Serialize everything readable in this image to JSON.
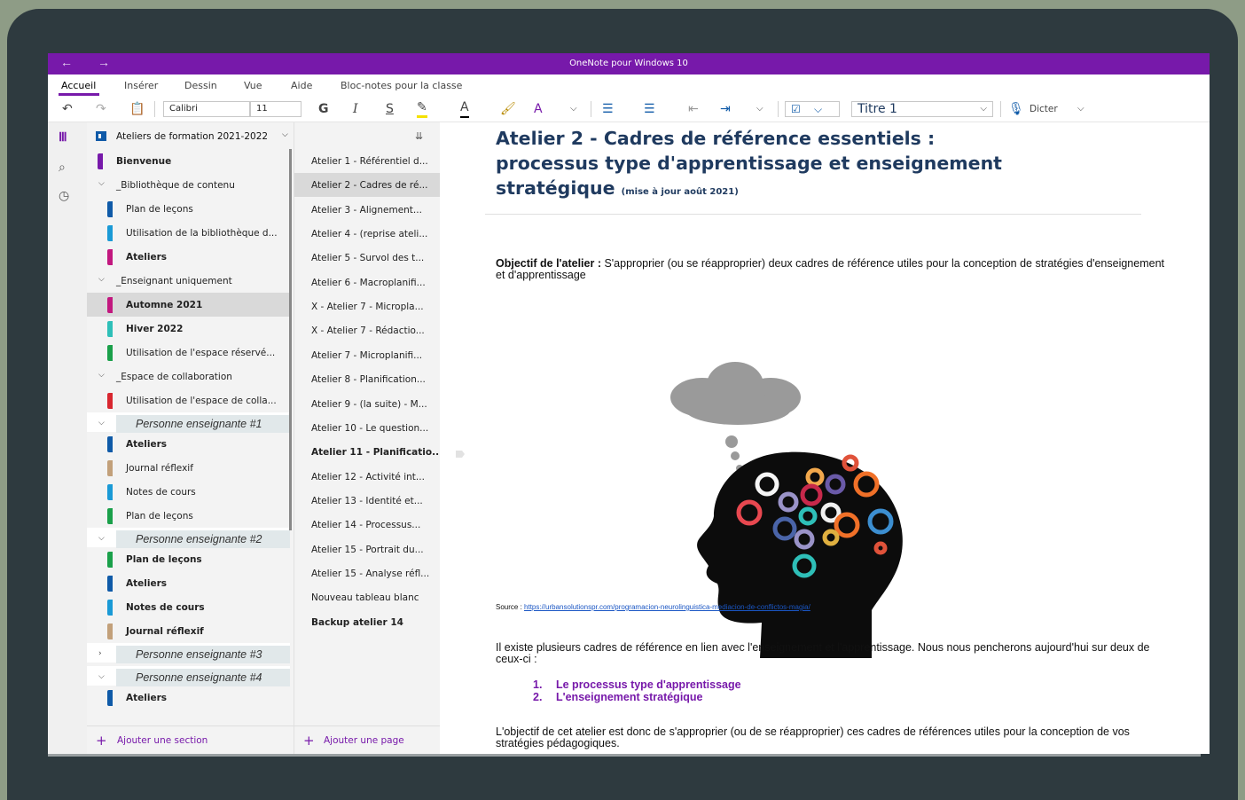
{
  "app": {
    "window_title": "OneNote pour Windows 10",
    "nav_back": "←",
    "nav_forward": "→"
  },
  "ribbon": {
    "tabs": [
      "Accueil",
      "Insérer",
      "Dessin",
      "Vue",
      "Aide",
      "Bloc-notes pour la classe"
    ],
    "active_tab": "Accueil"
  },
  "toolbar": {
    "font_name": "Calibri",
    "font_size": "11",
    "bold": "G",
    "italic": "I",
    "underline": "S",
    "style": "Titre 1",
    "dictate": "Dicter"
  },
  "notebook": {
    "title": "Ateliers de formation 2021-2022"
  },
  "sections": [
    {
      "label": "Bienvenue",
      "kind": "section",
      "color": "#7719aa",
      "bold": true,
      "indent": 0
    },
    {
      "label": "_Bibliothèque de contenu",
      "kind": "group",
      "expanded": true
    },
    {
      "label": "Plan de leçons",
      "kind": "section",
      "color": "#0f5aa8",
      "bold": false,
      "indent": 1
    },
    {
      "label": "Utilisation de la bibliothèque d...",
      "kind": "section",
      "color": "#1a9ad6",
      "bold": false,
      "indent": 1
    },
    {
      "label": "Ateliers",
      "kind": "section",
      "color": "#c2187f",
      "bold": true,
      "indent": 1
    },
    {
      "label": "_Enseignant uniquement",
      "kind": "group",
      "expanded": true
    },
    {
      "label": "Automne 2021",
      "kind": "section",
      "color": "#c2187f",
      "bold": true,
      "indent": 1,
      "selected": true
    },
    {
      "label": "Hiver 2022",
      "kind": "section",
      "color": "#2ebfb8",
      "bold": true,
      "indent": 1
    },
    {
      "label": "Utilisation de l'espace réservé...",
      "kind": "section",
      "color": "#1aa04a",
      "bold": false,
      "indent": 1
    },
    {
      "label": "_Espace de collaboration",
      "kind": "group",
      "expanded": true
    },
    {
      "label": "Utilisation de l'espace de colla...",
      "kind": "section",
      "color": "#d8262f",
      "bold": false,
      "indent": 1
    },
    {
      "label": "Personne enseignante #1",
      "kind": "group-italic",
      "expanded": true
    },
    {
      "label": "Ateliers",
      "kind": "section",
      "color": "#0f5aa8",
      "bold": true,
      "indent": 1
    },
    {
      "label": "Journal réflexif",
      "kind": "section",
      "color": "#c2a07a",
      "bold": false,
      "indent": 1
    },
    {
      "label": "Notes de cours",
      "kind": "section",
      "color": "#1a9ad6",
      "bold": false,
      "indent": 1
    },
    {
      "label": "Plan de leçons",
      "kind": "section",
      "color": "#1aa04a",
      "bold": false,
      "indent": 1
    },
    {
      "label": "Personne enseignante #2",
      "kind": "group-italic",
      "expanded": true
    },
    {
      "label": "Plan de leçons",
      "kind": "section",
      "color": "#1aa04a",
      "bold": true,
      "indent": 1
    },
    {
      "label": "Ateliers",
      "kind": "section",
      "color": "#0f5aa8",
      "bold": true,
      "indent": 1
    },
    {
      "label": "Notes de cours",
      "kind": "section",
      "color": "#1a9ad6",
      "bold": true,
      "indent": 1
    },
    {
      "label": "Journal réflexif",
      "kind": "section",
      "color": "#c2a07a",
      "bold": true,
      "indent": 1
    },
    {
      "label": "Personne enseignante #3",
      "kind": "group-italic",
      "expanded": false
    },
    {
      "label": "Personne enseignante #4",
      "kind": "group-italic",
      "expanded": true
    },
    {
      "label": "Ateliers",
      "kind": "section",
      "color": "#0f5aa8",
      "bold": true,
      "indent": 1
    }
  ],
  "add_section_label": "Ajouter une section",
  "pages": [
    {
      "label": "Atelier 1 - Référentiel d..."
    },
    {
      "label": "Atelier 2 - Cadres de ré...",
      "selected": true
    },
    {
      "label": "Atelier 3 - Alignement..."
    },
    {
      "label": "Atelier 4 - (reprise ateli..."
    },
    {
      "label": "Atelier 5 - Survol des t..."
    },
    {
      "label": "Atelier 6 - Macroplanifi..."
    },
    {
      "label": "X - Atelier 7 - Micropla..."
    },
    {
      "label": "X - Atelier 7 - Rédactio..."
    },
    {
      "label": "Atelier 7 - Microplanifi..."
    },
    {
      "label": "Atelier 8 - Planification..."
    },
    {
      "label": "Atelier 9 - (la suite) - M..."
    },
    {
      "label": "Atelier 10 - Le question..."
    },
    {
      "label": "Atelier 11 - Planificatio...",
      "bold": true
    },
    {
      "label": "Atelier 12 - Activité int..."
    },
    {
      "label": "Atelier 13 - Identité et..."
    },
    {
      "label": "Atelier 14 - Processus..."
    },
    {
      "label": "Atelier 15 - Portrait du..."
    },
    {
      "label": "Atelier 15 - Analyse réfl..."
    },
    {
      "label": "Nouveau tableau blanc"
    },
    {
      "label": "Backup atelier 14",
      "bold": true
    }
  ],
  "add_page_label": "Ajouter une page",
  "page_content": {
    "title_line1": "Atelier 2 - Cadres de référence essentiels :",
    "title_line2": "processus type d'apprentissage et enseignement",
    "title_line3": "stratégique",
    "title_note": "(mise à jour août 2021)",
    "objective_label": "Objectif de l'atelier :",
    "objective_text": " S'approprier (ou se réapproprier) deux cadres de référence utiles pour la conception de stratégies d'enseignement et d'apprentissage",
    "source_label": "Source : ",
    "source_url": "https://urbansolutionspr.com/programacion-neurolinguistica-mediacion-de-conflictos-magia/",
    "intro_text": "Il existe plusieurs cadres de référence en lien avec l'enseignement et l'apprentissage. Nous nous pencherons aujourd'hui sur deux de ceux-ci :",
    "list": [
      {
        "num": "1.",
        "text": "Le processus type d'apprentissage"
      },
      {
        "num": "2.",
        "text": "L'enseignement stratégique"
      }
    ],
    "conclusion_text": "L'objectif de cet atelier est donc de s'approprier (ou de se réapproprier) ces cadres de références utiles pour la conception de vos stratégies pédagogiques."
  },
  "colors": {
    "accent": "#7719aa",
    "title_color": "#1f3a5f"
  }
}
